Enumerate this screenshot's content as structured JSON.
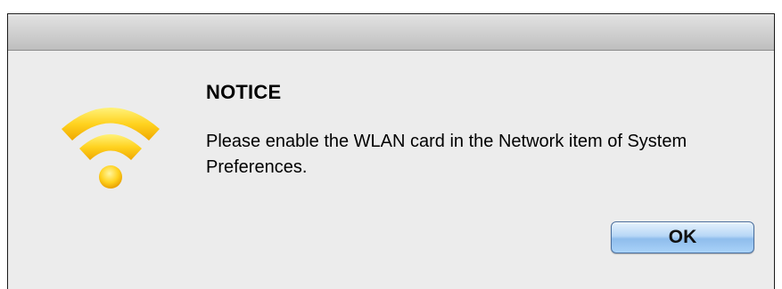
{
  "dialog": {
    "icon": "wifi-icon",
    "title": "NOTICE",
    "message": "Please enable the WLAN card in the Network item of System Preferences.",
    "ok_label": "OK"
  },
  "colors": {
    "wifi_yellow": "#f5b90f",
    "wifi_yellow_light": "#ffe566",
    "button_blue": "#9fcaf4",
    "window_bg": "#ececec"
  }
}
